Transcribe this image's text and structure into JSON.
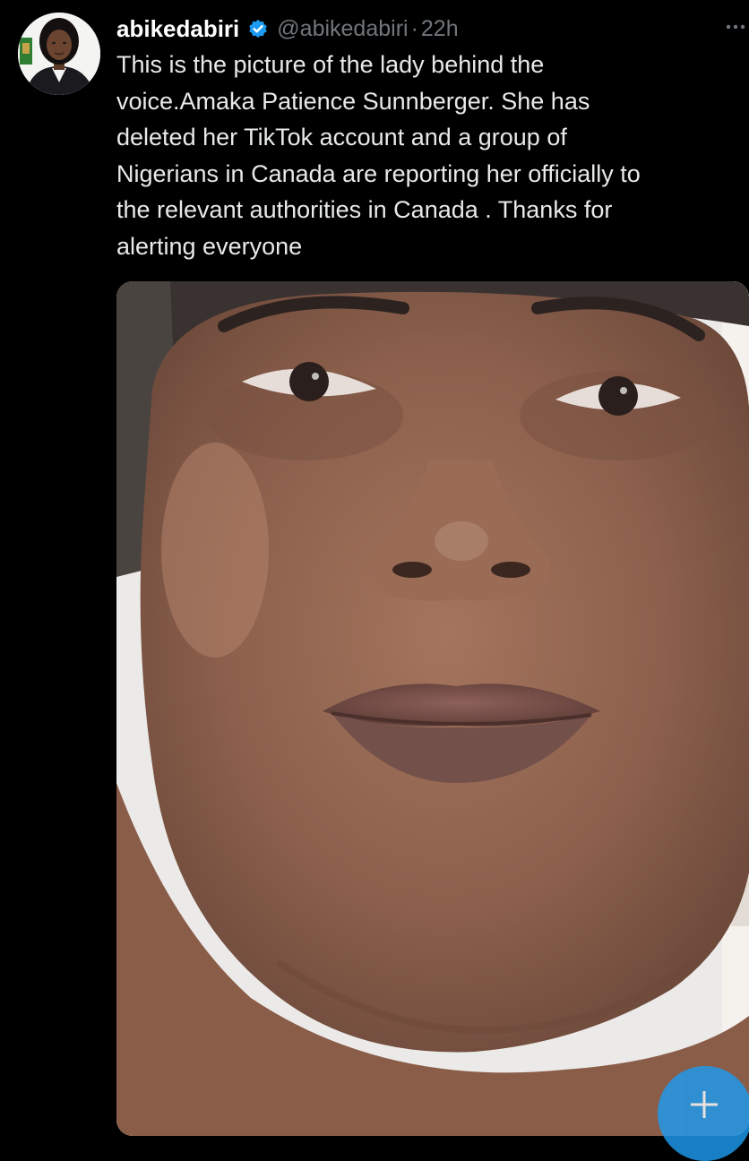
{
  "tweet": {
    "display_name": "abikedabiri",
    "handle": "@abikedabiri",
    "separator": "·",
    "time": "22h",
    "text": "This is the picture of the lady behind the\nvoice.Amaka Patience Sunnberger. She has\ndeleted her TikTok account and a group of\nNigerians in Canada are reporting her officially to\nthe relevant authorities in Canada . Thanks for\nalerting everyone",
    "verified_icon": "verified-badge-icon",
    "more_icon": "more-options-icon"
  },
  "compose": {
    "icon": "plus-icon"
  },
  "colors": {
    "background": "#000000",
    "primary_text": "#e7e9ea",
    "secondary_text": "#71767b",
    "accent": "#1d9bf0"
  }
}
